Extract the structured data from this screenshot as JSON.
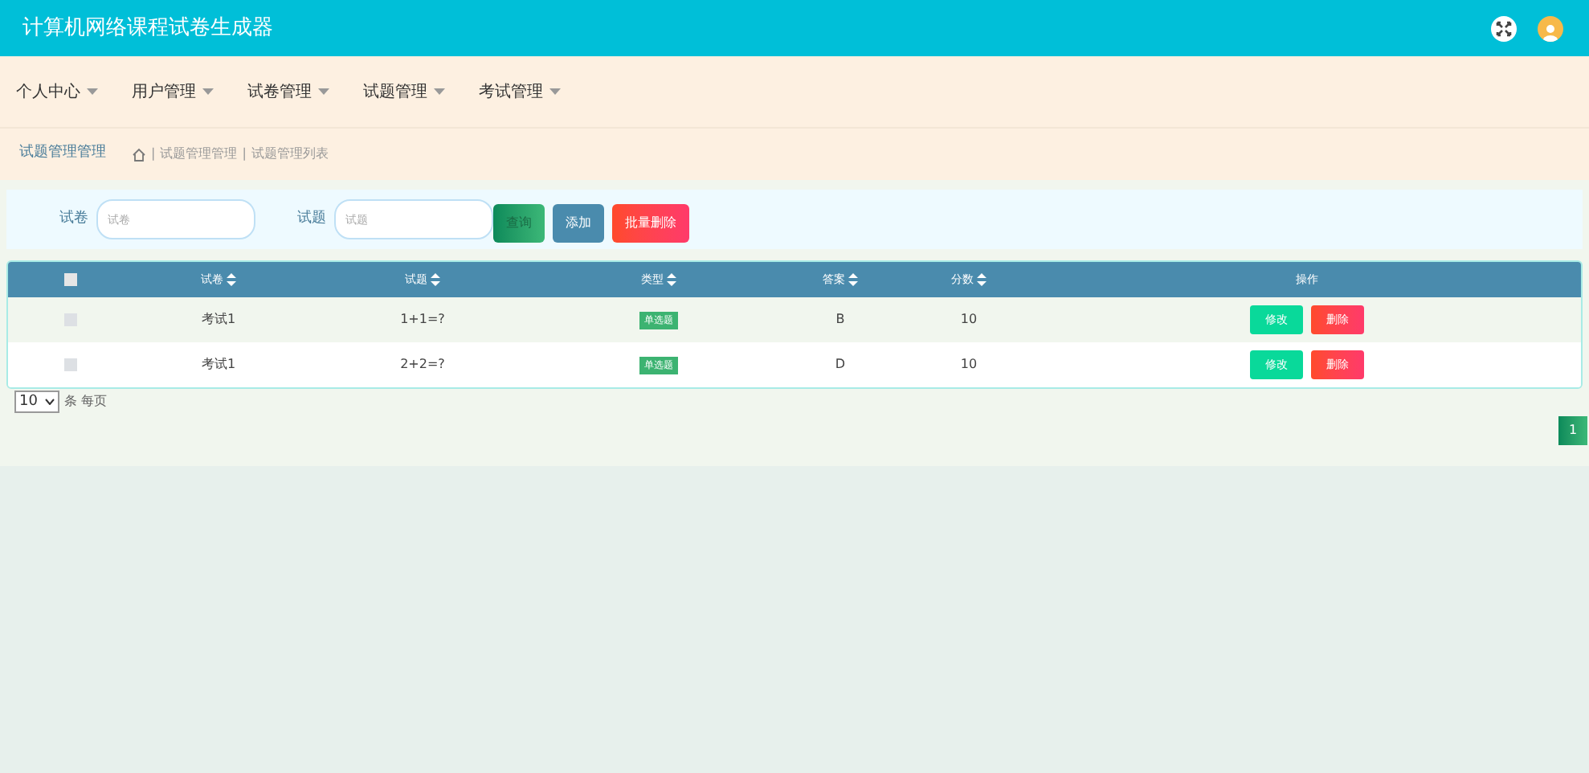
{
  "header": {
    "title": "计算机网络课程试卷生成器"
  },
  "nav": [
    {
      "label": "个人中心"
    },
    {
      "label": "用户管理"
    },
    {
      "label": "试卷管理"
    },
    {
      "label": "试题管理"
    },
    {
      "label": "考试管理"
    }
  ],
  "breadcrumb": {
    "title": "试题管理管理",
    "separator": "|",
    "path": [
      "试题管理管理",
      "试题管理列表"
    ]
  },
  "search": {
    "fields": [
      {
        "label": "试卷",
        "placeholder": "试卷"
      },
      {
        "label": "试题",
        "placeholder": "试题"
      }
    ],
    "buttons": [
      {
        "label": "查询",
        "kind": "search"
      },
      {
        "label": "添加",
        "kind": "add"
      },
      {
        "label": "批量删除",
        "kind": "delete"
      }
    ]
  },
  "table": {
    "all_checked": false,
    "columns": [
      "试卷",
      "试题",
      "类型",
      "答案",
      "分数",
      "操作"
    ],
    "rows": [
      {
        "checked": false,
        "cells": [
          "考试1",
          "1+1=?",
          "单选题",
          "B",
          "10"
        ],
        "actions": [
          "修改",
          "删除"
        ]
      },
      {
        "checked": false,
        "cells": [
          "考试1",
          "2+2=?",
          "单选题",
          "D",
          "10"
        ],
        "actions": [
          "修改",
          "删除"
        ]
      }
    ]
  },
  "pagination": {
    "page_size": "10",
    "page_size_label": "条 每页",
    "pages": [
      {
        "label": "1",
        "selected": true
      }
    ]
  }
}
